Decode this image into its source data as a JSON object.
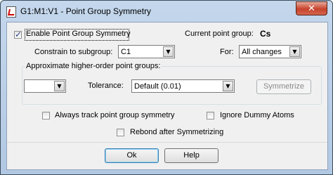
{
  "window": {
    "title": "G1:M1:V1 - Point Group Symmetry",
    "close_label": "✕"
  },
  "icons": {
    "app": "document-icon",
    "close": "close-icon",
    "dropdown": "chevron-down-icon"
  },
  "enable_symmetry": {
    "label": "Enable Point Group Symmetry",
    "checked": true
  },
  "current_point_group": {
    "label": "Current point group:",
    "value": "Cs"
  },
  "constrain": {
    "label": "Constrain to subgroup:",
    "value": "C1"
  },
  "for": {
    "label": "For:",
    "value": "All changes"
  },
  "approx_group": {
    "label": "Approximate higher-order point groups:",
    "group_value": "",
    "tolerance_label": "Tolerance:",
    "tolerance_value": "Default (0.01)",
    "symmetrize_label": "Symmetrize"
  },
  "options": {
    "always_track": {
      "label": "Always track point group symmetry",
      "checked": false
    },
    "ignore_dummy": {
      "label": "Ignore Dummy Atoms",
      "checked": false
    },
    "rebond": {
      "label": "Rebond after Symmetrizing",
      "checked": false
    }
  },
  "buttons": {
    "ok": "Ok",
    "help": "Help"
  },
  "colors": {
    "title_bar": "#b9cee6",
    "close_button": "#c7422b",
    "dialog_bg": "#f0f0f0"
  }
}
